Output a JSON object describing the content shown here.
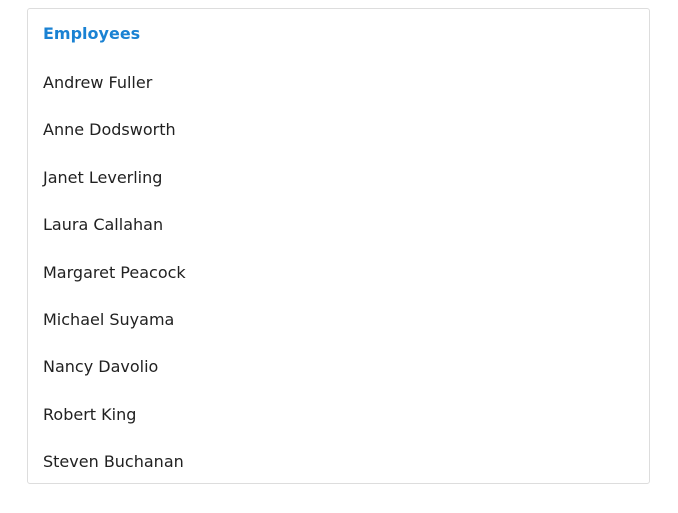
{
  "list": {
    "header": "Employees",
    "items": [
      "Andrew Fuller",
      "Anne Dodsworth",
      "Janet Leverling",
      "Laura Callahan",
      "Margaret Peacock",
      "Michael Suyama",
      "Nancy Davolio",
      "Robert King",
      "Steven Buchanan"
    ]
  },
  "colors": {
    "header_text": "#1a82d3",
    "item_text": "#212121",
    "border": "#dddddd",
    "background": "#ffffff"
  }
}
